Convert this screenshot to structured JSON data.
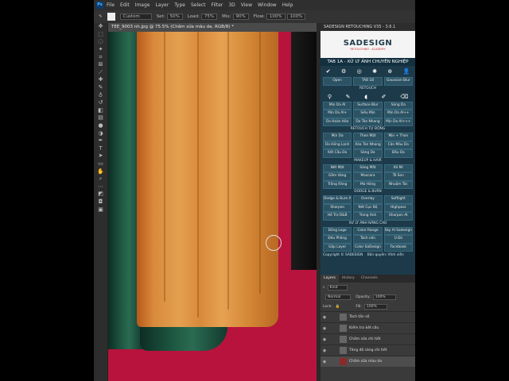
{
  "menubar": {
    "logo": "Ps",
    "items": [
      "File",
      "Edit",
      "Image",
      "Layer",
      "Type",
      "Select",
      "Filter",
      "3D",
      "View",
      "Window",
      "Help"
    ]
  },
  "options_bar": {
    "mode": "Custom",
    "set1": "Set:",
    "set1_value": "50%",
    "load": "Load:",
    "load_value": "75%",
    "mix": "Mix:",
    "mix_value": "90%",
    "flow": "Flow:",
    "flow_value": "100%",
    "extra": "100%"
  },
  "document_tab": "TEE_9003 nh.jpg @ 75.5% (Chấm sửa màu da, RGB/8) *",
  "panel": {
    "title": "SADESIGN RETOUCHING V35 - 3.6.1",
    "brand_name": "SADESIGN",
    "brand_sub": "RETOUCHING · ACADEMY",
    "tab_title": "TAB 1A - XỬ LÝ ẢNH CHUYÊN NGHIỆP",
    "top_buttons": [
      "Open",
      "TAB 1B",
      "Gaussian Blur"
    ],
    "sections": [
      {
        "heading": "RETOUCH",
        "rows": [
          [
            "Mịn Da AI",
            "Surface Blur",
            "Sáng Da"
          ],
          [
            "Mịn Da AI+",
            "Siêu Mịn",
            "Mịn Da AI++"
          ],
          [
            "Da Hoàn Hảo",
            "Da Tàn Nhang",
            "Mịn Da AI+++"
          ]
        ]
      },
      {
        "heading": "RETOUCH TỰ ĐỘNG",
        "rows": [
          [
            "Mịn Da",
            "Thon Mặt",
            "Mịn + Thon"
          ],
          [
            "Da Hồng Lạnh",
            "Xóa Tàn Nhang",
            "Cân Màu Da"
          ],
          [
            "Kết Cấu Da",
            "Sáng Da",
            "Đều Da"
          ]
        ]
      },
      {
        "heading": "MAKEUP & HAIR",
        "rows": [
          [
            "Nét Mặt",
            "Sáng Mắt",
            "Kẻ Mi"
          ],
          [
            "Gắm Vàng",
            "Mascara",
            "Tô Son"
          ],
          [
            "Trắng Răng",
            "Má Hồng",
            "Nhuộm Tóc"
          ]
        ]
      },
      {
        "heading": "DODGE & BURN",
        "rows": [
          [
            "Dodge & Burn AI",
            "Overlay",
            "Softlight"
          ],
          [
            "Sharpen",
            "Nét Cục Bộ",
            "Highpass"
          ],
          [
            "Hỗ Trợ D&B",
            "Trong Ảnh",
            "Sharpen AI"
          ]
        ]
      },
      {
        "heading": "XỬ LÝ ẢNH NÂNG CAO",
        "rows": [
          [
            "Đồng Logo",
            "Color Range",
            "Sky AI Sadesign"
          ],
          [
            "Đều Phông",
            "Tách nền",
            "Ủ Đỏ"
          ],
          [
            "Gộp Layer",
            "Color SaDesign",
            "Facebook"
          ]
        ]
      }
    ],
    "copyright": "Copyright © SADESIGN",
    "rights": "Bản quyền: Vĩnh viễn"
  },
  "layers_panel": {
    "tabs": [
      "Layers",
      "History",
      "Channels"
    ],
    "kind": "Kind",
    "blend_mode": "Normal",
    "opacity_label": "Opacity:",
    "opacity": "100%",
    "lock_label": "Lock:",
    "fill_label": "Fill:",
    "fill": "100%",
    "layers": [
      {
        "name": "Tách tần số",
        "selected": false
      },
      {
        "name": "Kiểm tra kết cấu",
        "selected": false
      },
      {
        "name": "Chấm sửa chi tiết",
        "selected": false
      },
      {
        "name": "Tăng độ sáng chi tiết",
        "selected": false
      },
      {
        "name": "Chấm sửa màu da",
        "selected": true
      }
    ]
  },
  "colors": {
    "panel_bg": "#1d3a4a",
    "button_bg": "#2c5364",
    "canvas_bg": "#b8133c"
  }
}
